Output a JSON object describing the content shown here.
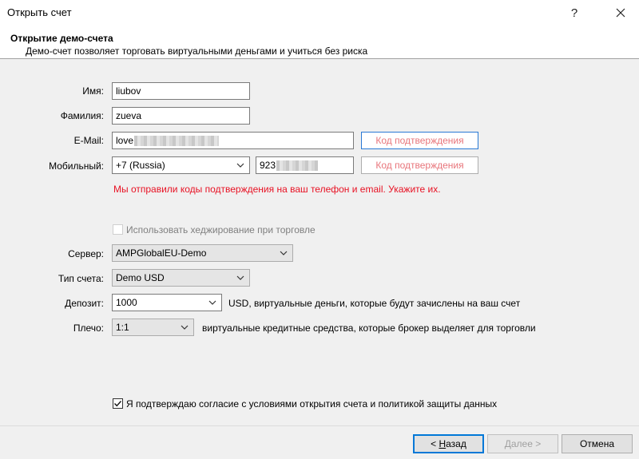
{
  "window": {
    "title": "Открыть счет",
    "help_glyph": "?",
    "close_glyph": "✕"
  },
  "header": {
    "title": "Открытие демо-счета",
    "subtitle": "Демо-счет позволяет торговать виртуальными деньгами и учиться без риска"
  },
  "form": {
    "first_name": {
      "label": "Имя:",
      "value": "liubov"
    },
    "last_name": {
      "label": "Фамилия:",
      "value": "zueva"
    },
    "email": {
      "label": "E-Mail:",
      "value": "love",
      "code_button": "Код подтверждения"
    },
    "mobile": {
      "label": "Мобильный:",
      "country": "+7 (Russia)",
      "value": "923",
      "code_button": "Код подтверждения"
    },
    "warning": "Мы отправили коды подтверждения на ваш телефон и email. Укажите их.",
    "hedging": {
      "label": "Использовать хеджирование при торговле",
      "checked": false,
      "enabled": false
    },
    "server": {
      "label": "Сервер:",
      "value": "AMPGlobalEU-Demo"
    },
    "account_type": {
      "label": "Тип счета:",
      "value": "Demo USD"
    },
    "deposit": {
      "label": "Депозит:",
      "value": "1000",
      "note": "USD, виртуальные деньги, которые будут зачислены на ваш счет"
    },
    "leverage": {
      "label": "Плечо:",
      "value": "1:1",
      "note": "виртуальные кредитные средства, которые брокер выделяет для торговли"
    },
    "agreement": {
      "label": "Я подтверждаю согласие с условиями открытия счета и политикой защиты данных",
      "checked": true
    }
  },
  "buttons": {
    "back": {
      "prefix": "< ",
      "hotkey": "Н",
      "rest": "азад"
    },
    "next": "Далее >",
    "cancel": "Отмена"
  },
  "colors": {
    "warning": "#e81123",
    "code_button_text": "#e8757b",
    "focus_border": "#2979d4"
  }
}
